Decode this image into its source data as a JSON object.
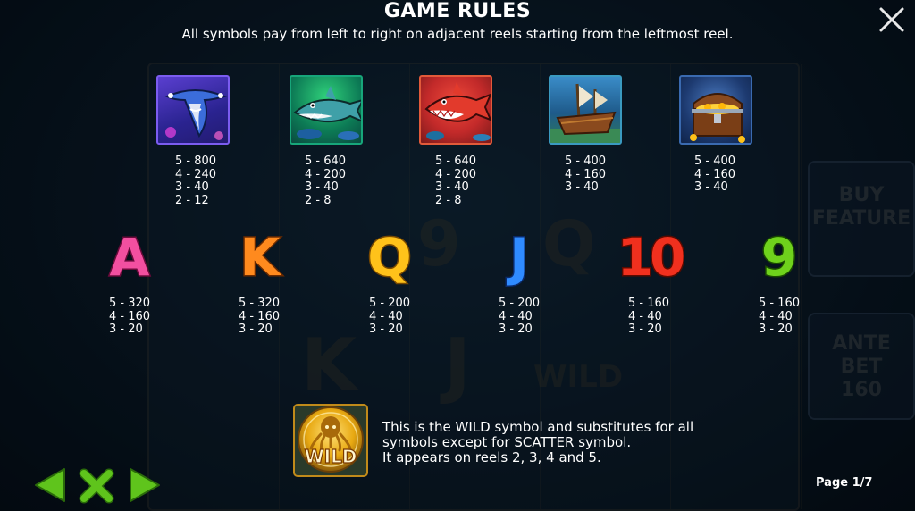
{
  "header": {
    "title": "GAME RULES",
    "subtitle": "All symbols pay from left to right on adjacent reels starting from the leftmost reel."
  },
  "background": {
    "buy_feature": "BUY FEATURE",
    "ante_bet": "ANTE BET",
    "ante_value": "160"
  },
  "high_symbols": [
    {
      "icon": "hammerhead-shark-icon",
      "pays": [
        "5 - 800",
        "4 - 240",
        "3 - 40",
        "2 - 12"
      ]
    },
    {
      "icon": "green-shark-icon",
      "pays": [
        "5 - 640",
        "4 - 200",
        "3 - 40",
        "2 - 8"
      ]
    },
    {
      "icon": "red-shark-icon",
      "pays": [
        "5 - 640",
        "4 - 200",
        "3 - 40",
        "2 - 8"
      ]
    },
    {
      "icon": "sunken-ship-icon",
      "pays": [
        "5 - 400",
        "4 - 160",
        "3 - 40"
      ]
    },
    {
      "icon": "treasure-chest-icon",
      "pays": [
        "5 - 400",
        "4 - 160",
        "3 - 40"
      ]
    }
  ],
  "low_symbols": [
    {
      "label": "A",
      "color": "#f24fa0",
      "pays": [
        "5 - 320",
        "4 - 160",
        "3 - 20"
      ]
    },
    {
      "label": "K",
      "color": "#ff8a1e",
      "pays": [
        "5 - 320",
        "4 - 160",
        "3 - 20"
      ]
    },
    {
      "label": "Q",
      "color": "#ffc21a",
      "pays": [
        "5 - 200",
        "4 - 40",
        "3 - 20"
      ]
    },
    {
      "label": "J",
      "color": "#2f8bff",
      "pays": [
        "5 - 200",
        "4 - 40",
        "3 - 20"
      ]
    },
    {
      "label": "10",
      "color": "#f0301e",
      "pays": [
        "5 - 160",
        "4 - 40",
        "3 - 20"
      ]
    },
    {
      "label": "9",
      "color": "#6fd21c",
      "pays": [
        "5 - 160",
        "4 - 40",
        "3 - 20"
      ]
    }
  ],
  "wild": {
    "label": "WILD",
    "lines": [
      "This is the WILD symbol and substitutes for all",
      "symbols except for SCATTER symbol.",
      "It appears on reels 2, 3, 4 and 5."
    ]
  },
  "footer": {
    "page_indicator": "Page 1/7"
  },
  "colors": {
    "nav_green": "#5fc41c",
    "wild_gold": "#e8a912"
  }
}
